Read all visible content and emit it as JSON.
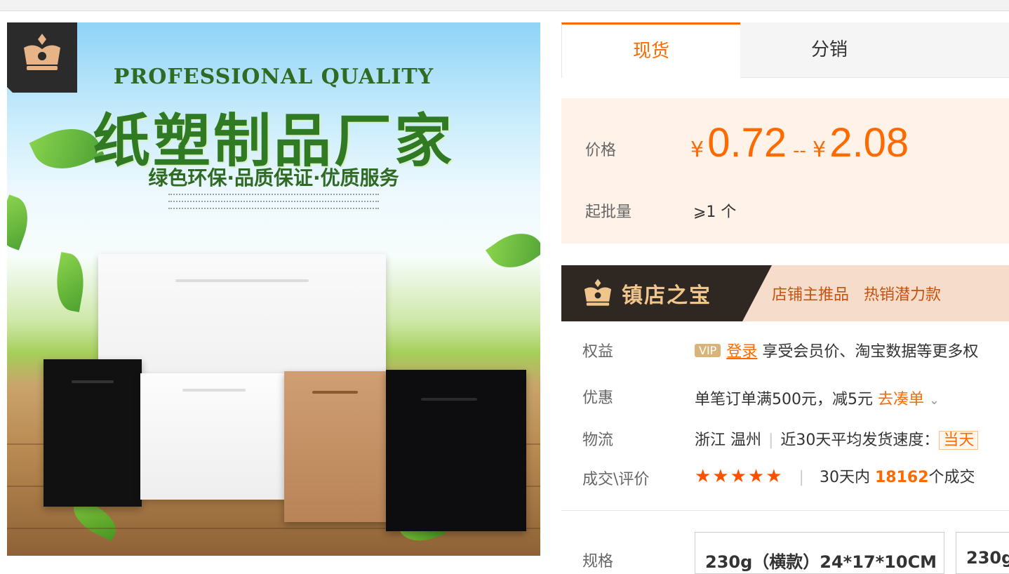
{
  "hero": {
    "headline_en": "PROFESSIONAL QUALITY",
    "headline_cn": "纸塑制品厂家",
    "subline": "绿色环保·品质保证·优质服务"
  },
  "tabs": [
    {
      "label": "现货",
      "active": true
    },
    {
      "label": "分销",
      "active": false
    }
  ],
  "price": {
    "label": "价格",
    "currency": "¥",
    "low": "0.72",
    "separator": "--",
    "high": "2.08"
  },
  "moq": {
    "label": "起批量",
    "value": "⩾1 个"
  },
  "treasure": {
    "title": "镇店之宝",
    "tag1": "店铺主推品",
    "tag2": "热销潜力款"
  },
  "benefits": {
    "label": "权益",
    "vip": "VIP",
    "login": "登录",
    "text": "享受会员价、淘宝数据等更多权"
  },
  "discount": {
    "label": "优惠",
    "text": "单笔订单满500元，减5元",
    "action": "去凑单"
  },
  "logistics": {
    "label": "物流",
    "origin": "浙江 温州",
    "speed_label": "近30天平均发货速度：",
    "speed_value": "当天"
  },
  "trade": {
    "label": "成交\\评价",
    "rating": 5,
    "prefix": "30天内",
    "count": "18162",
    "suffix": "个成交"
  },
  "spec": {
    "label": "规格",
    "options": [
      "230g（横款）24*17*10CM",
      "230g"
    ]
  },
  "colors": {
    "accent": "#ff6a00",
    "price_bg": "#fff2e8"
  }
}
